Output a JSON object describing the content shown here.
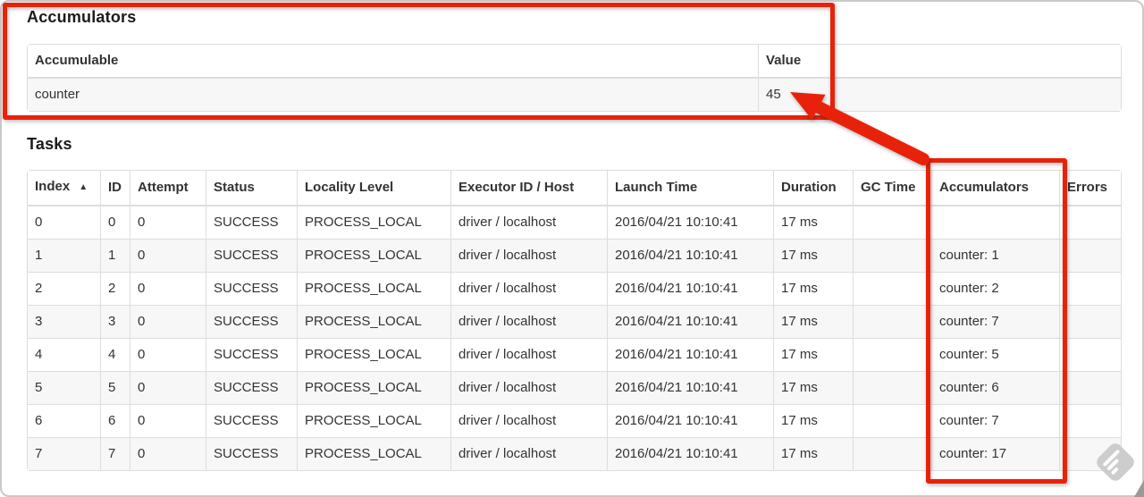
{
  "colors": {
    "annotation_red": "#e8220a",
    "table_border": "#dddddd",
    "row_stripe": "#f7f7f7",
    "text": "#333333"
  },
  "accumulators_section": {
    "title": "Accumulators",
    "table": {
      "col_accumulable": "Accumulable",
      "col_value": "Value",
      "row": {
        "accumulable": "counter",
        "value": "45"
      }
    }
  },
  "tasks_section": {
    "title": "Tasks",
    "table": {
      "headers": [
        "Index",
        "ID",
        "Attempt",
        "Status",
        "Locality Level",
        "Executor ID / Host",
        "Launch Time",
        "Duration",
        "GC Time",
        "Accumulators",
        "Errors"
      ],
      "sort_icon": "▲",
      "rows": [
        [
          "0",
          "0",
          "0",
          "SUCCESS",
          "PROCESS_LOCAL",
          "driver / localhost",
          "2016/04/21 10:10:41",
          "17 ms",
          "",
          "",
          ""
        ],
        [
          "1",
          "1",
          "0",
          "SUCCESS",
          "PROCESS_LOCAL",
          "driver / localhost",
          "2016/04/21 10:10:41",
          "17 ms",
          "",
          "counter: 1",
          ""
        ],
        [
          "2",
          "2",
          "0",
          "SUCCESS",
          "PROCESS_LOCAL",
          "driver / localhost",
          "2016/04/21 10:10:41",
          "17 ms",
          "",
          "counter: 2",
          ""
        ],
        [
          "3",
          "3",
          "0",
          "SUCCESS",
          "PROCESS_LOCAL",
          "driver / localhost",
          "2016/04/21 10:10:41",
          "17 ms",
          "",
          "counter: 7",
          ""
        ],
        [
          "4",
          "4",
          "0",
          "SUCCESS",
          "PROCESS_LOCAL",
          "driver / localhost",
          "2016/04/21 10:10:41",
          "17 ms",
          "",
          "counter: 5",
          ""
        ],
        [
          "5",
          "5",
          "0",
          "SUCCESS",
          "PROCESS_LOCAL",
          "driver / localhost",
          "2016/04/21 10:10:41",
          "17 ms",
          "",
          "counter: 6",
          ""
        ],
        [
          "6",
          "6",
          "0",
          "SUCCESS",
          "PROCESS_LOCAL",
          "driver / localhost",
          "2016/04/21 10:10:41",
          "17 ms",
          "",
          "counter: 7",
          ""
        ],
        [
          "7",
          "7",
          "0",
          "SUCCESS",
          "PROCESS_LOCAL",
          "driver / localhost",
          "2016/04/21 10:10:41",
          "17 ms",
          "",
          "counter: 17",
          ""
        ]
      ]
    }
  }
}
